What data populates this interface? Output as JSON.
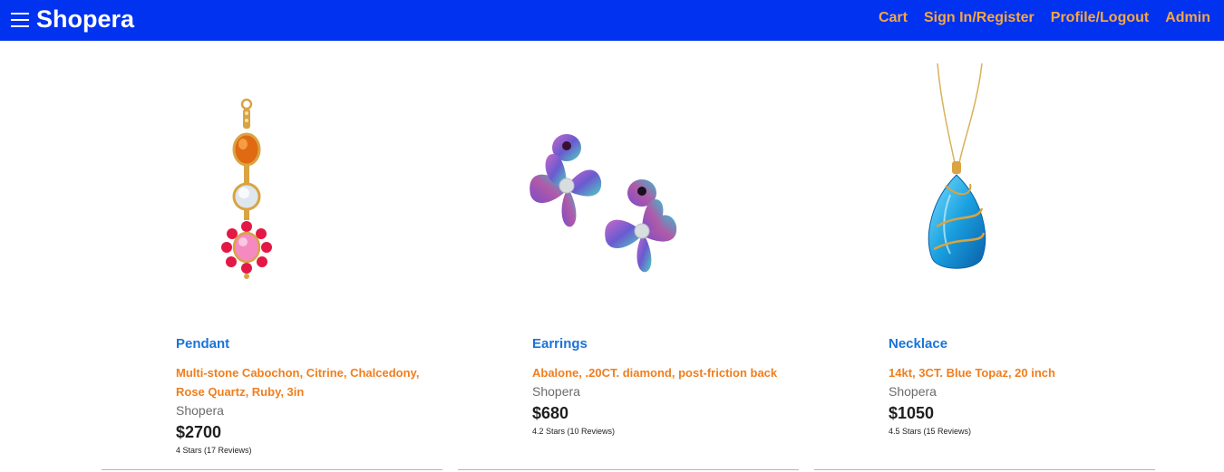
{
  "header": {
    "brand": "Shopera",
    "menu_icon": "hamburger-menu-icon",
    "nav": [
      "Cart",
      "Sign In/Register",
      "Profile/Logout",
      "Admin"
    ],
    "colors": {
      "bar": "#0032f0",
      "nav_text": "#f5a742",
      "brand_text": "#ffffff"
    }
  },
  "products": [
    {
      "name": "Pendant",
      "description": "Multi-stone Cabochon, Citrine, Chalcedony, Rose Quartz, Ruby, 3in",
      "seller": "Shopera",
      "price": "$2700",
      "rating": "4 Stars (17 Reviews)",
      "image_icon": "pendant-image"
    },
    {
      "name": "Earrings",
      "description": "Abalone, .20CT. diamond, post-friction back",
      "seller": "Shopera",
      "price": "$680",
      "rating": "4.2 Stars (10 Reviews)",
      "image_icon": "earrings-image"
    },
    {
      "name": "Necklace",
      "description": "14kt, 3CT. Blue Topaz, 20 inch",
      "seller": "Shopera",
      "price": "$1050",
      "rating": "4.5 Stars (15 Reviews)",
      "image_icon": "necklace-image"
    }
  ],
  "colors": {
    "product_name": "#1a73d9",
    "description": "#f07e1e",
    "seller": "#6b6b6b"
  }
}
